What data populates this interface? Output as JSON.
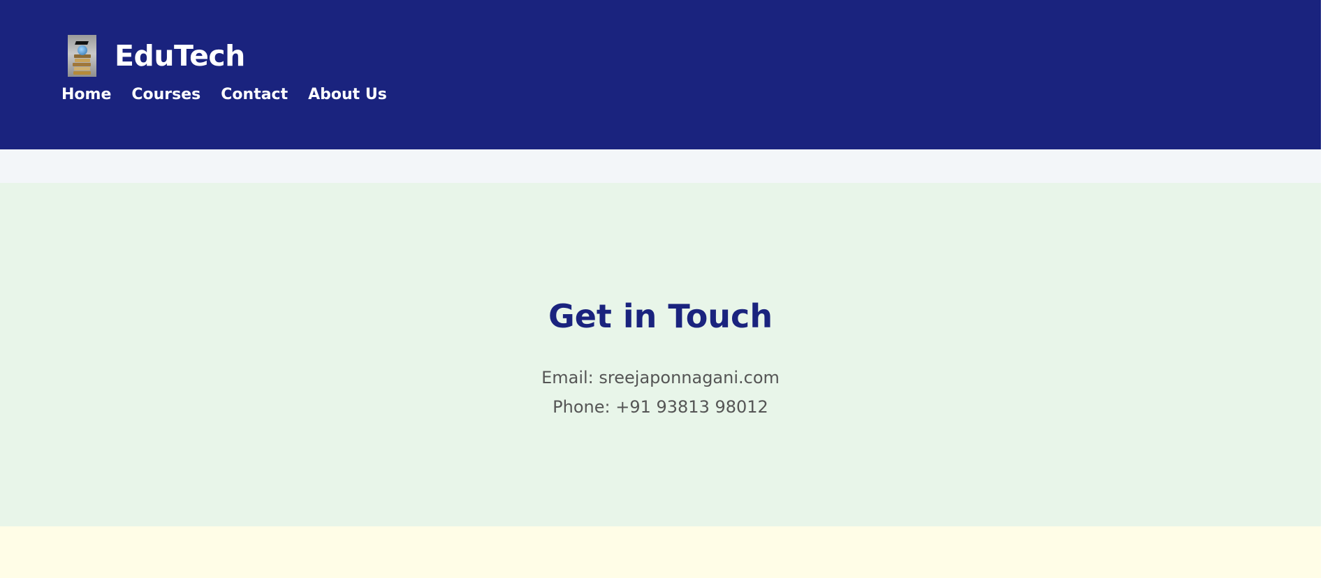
{
  "header": {
    "brand_name": "EduTech",
    "logo_icon": "graduation-books-logo",
    "background_color": "#1a237e",
    "nav": [
      {
        "label": "Home"
      },
      {
        "label": "Courses"
      },
      {
        "label": "Contact"
      },
      {
        "label": "About Us"
      }
    ]
  },
  "contact": {
    "title": "Get in Touch",
    "email_line": "Email: sreejaponnagani.com",
    "phone_line": "Phone: +91 93813 98012",
    "background_color": "#e8f5e9",
    "title_color": "#1a237e"
  },
  "colors": {
    "strip": "#f3f6f9",
    "footer_band": "#fffde7"
  }
}
